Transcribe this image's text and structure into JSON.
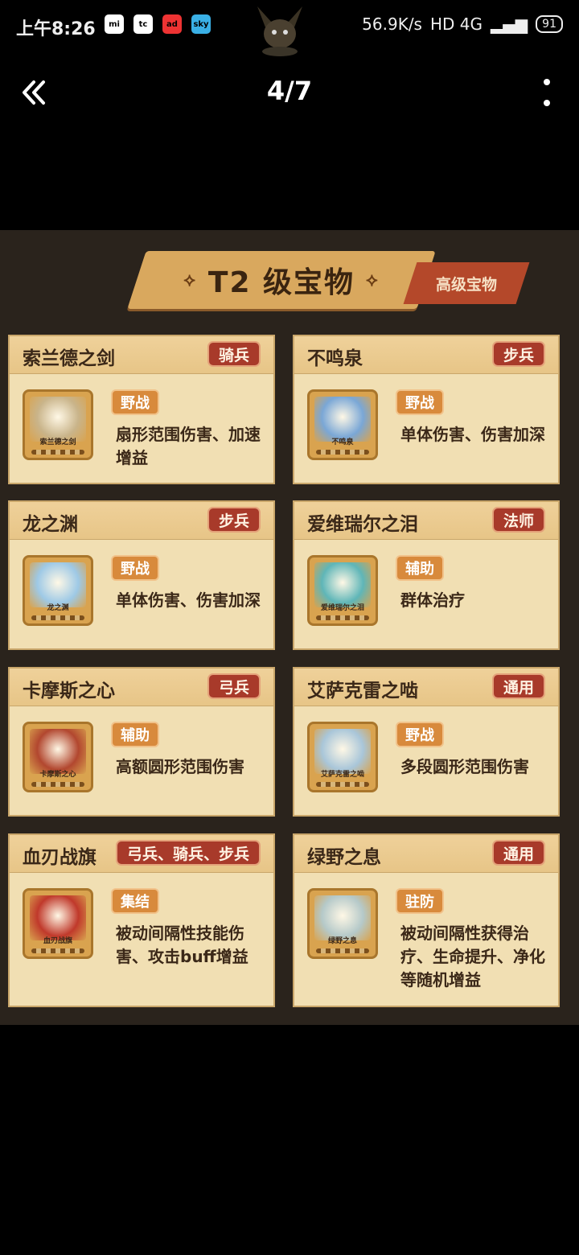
{
  "status": {
    "time": "上午8:26",
    "apps": [
      "mi",
      "tc",
      "ad",
      "sky"
    ],
    "speed": "56.9K/s",
    "network": "HD 4G",
    "battery": "91"
  },
  "top_bar": {
    "page_counter": "4/7"
  },
  "banner": {
    "title": "T2 级宝物",
    "ornament_left": "⟡",
    "ornament_right": "⟡",
    "sub": "高级宝物"
  },
  "cards": [
    {
      "name": "索兰德之剑",
      "troop": "骑兵",
      "type": "野战",
      "desc": "扇形范围伤害、加速增益",
      "icon_label": "索兰德之剑",
      "art_color": "#c9b48a"
    },
    {
      "name": "不鸣泉",
      "troop": "步兵",
      "type": "野战",
      "desc": "单体伤害、伤害加深",
      "icon_label": "不鸣泉",
      "art_color": "#7aa7d6"
    },
    {
      "name": "龙之渊",
      "troop": "步兵",
      "type": "野战",
      "desc": "单体伤害、伤害加深",
      "icon_label": "龙之渊",
      "art_color": "#9ec9e6"
    },
    {
      "name": "爱维瑞尔之泪",
      "troop": "法师",
      "type": "辅助",
      "desc": "群体治疗",
      "icon_label": "爱维瑞尔之泪",
      "art_color": "#5fb6b8"
    },
    {
      "name": "卡摩斯之心",
      "troop": "弓兵",
      "type": "辅助",
      "desc": "高额圆形范围伤害",
      "icon_label": "卡摩斯之心",
      "art_color": "#b2472f"
    },
    {
      "name": "艾萨克雷之啮",
      "troop": "通用",
      "type": "野战",
      "desc": "多段圆形范围伤害",
      "icon_label": "艾萨克雷之啮",
      "art_color": "#a9c6d9"
    },
    {
      "name": "血刃战旗",
      "troop": "弓兵、骑兵、步兵",
      "type": "集结",
      "desc": "被动间隔性技能伤害、攻击buff增益",
      "icon_label": "血刃战旗",
      "art_color": "#c0392b"
    },
    {
      "name": "绿野之息",
      "troop": "通用",
      "type": "驻防",
      "desc": "被动间隔性获得治疗、生命提升、净化等随机增益",
      "icon_label": "绿野之息",
      "art_color": "#b5c9c9"
    }
  ]
}
